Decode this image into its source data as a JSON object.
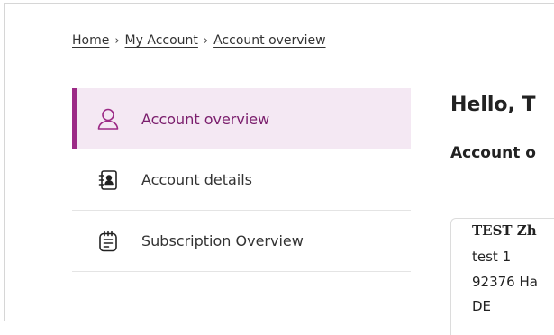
{
  "breadcrumb": {
    "home": "Home",
    "my_account": "My Account",
    "account_overview": "Account overview",
    "separator": "›"
  },
  "sidebar": {
    "items": [
      {
        "label": "Account overview",
        "icon": "user-icon",
        "active": true
      },
      {
        "label": "Account details",
        "icon": "contact-book-icon",
        "active": false
      },
      {
        "label": "Subscription Overview",
        "icon": "clipboard-list-icon",
        "active": false
      }
    ]
  },
  "main": {
    "greeting": "Hello, T",
    "subheading": "Account o",
    "address_card": {
      "name": "TEST Zh",
      "line1": "test 1",
      "line2": "92376 Ha",
      "line3": "DE"
    }
  },
  "colors": {
    "accent": "#9c2a86",
    "active_bg": "#f4e8f3",
    "active_text": "#7a1d6c"
  }
}
